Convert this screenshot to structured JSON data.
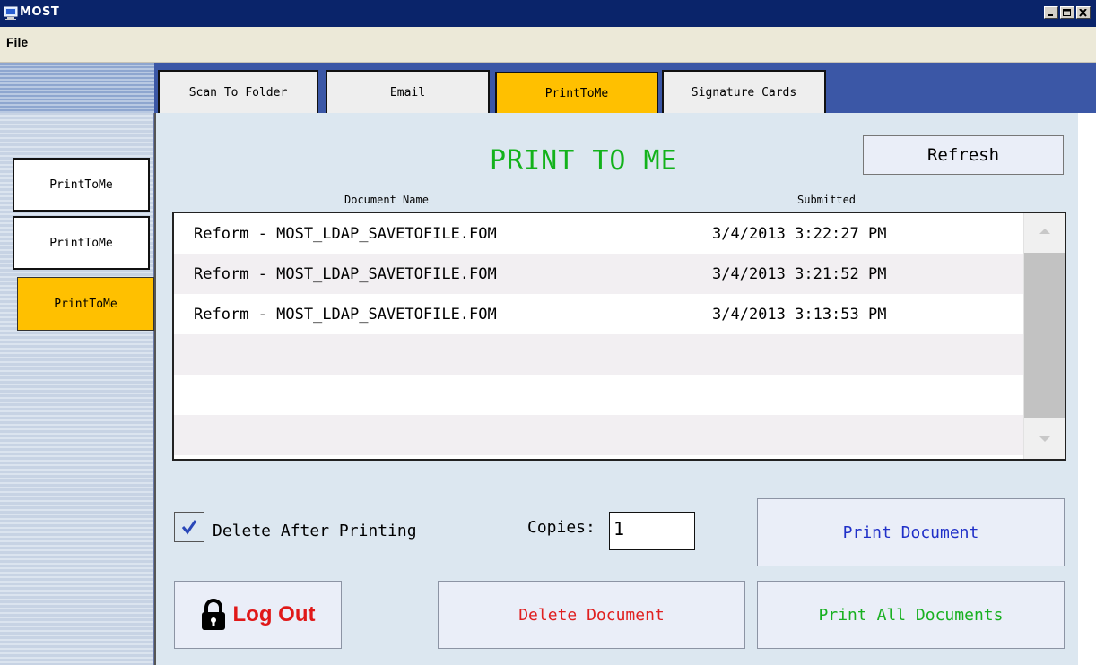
{
  "window": {
    "title": "MOST"
  },
  "menu": {
    "file": "File"
  },
  "tabs": [
    {
      "label": "Scan To Folder",
      "active": false
    },
    {
      "label": "Email",
      "active": false
    },
    {
      "label": "PrintToMe",
      "active": true
    },
    {
      "label": "Signature Cards",
      "active": false
    }
  ],
  "sidebar": {
    "items": [
      {
        "label": "PrintToMe",
        "active": false
      },
      {
        "label": "PrintToMe",
        "active": false
      },
      {
        "label": "PrintToMe",
        "active": true
      }
    ]
  },
  "main": {
    "title": "PRINT TO ME",
    "refresh_label": "Refresh",
    "columns": {
      "document_name": "Document Name",
      "submitted": "Submitted"
    },
    "rows": [
      {
        "document_name": "Reform - MOST_LDAP_SAVETOFILE.FOM",
        "submitted": "3/4/2013 3:22:27 PM"
      },
      {
        "document_name": "Reform - MOST_LDAP_SAVETOFILE.FOM",
        "submitted": "3/4/2013 3:21:52 PM"
      },
      {
        "document_name": "Reform - MOST_LDAP_SAVETOFILE.FOM",
        "submitted": "3/4/2013 3:13:53 PM"
      }
    ],
    "delete_after_printing_label": "Delete After Printing",
    "delete_after_printing_checked": true,
    "copies_label": "Copies:",
    "copies_value": "1",
    "print_document_label": "Print Document",
    "print_all_label": "Print All Documents",
    "delete_document_label": "Delete Document",
    "logout_label": "Log Out"
  },
  "colors": {
    "titlebar": "#0a246a",
    "tabstrip": "#3b57a6",
    "active_tab": "#ffc000",
    "title_green": "#13b21b",
    "print_blue": "#2030c8",
    "delete_red": "#e02020",
    "panel_bg": "#dce7f0"
  }
}
